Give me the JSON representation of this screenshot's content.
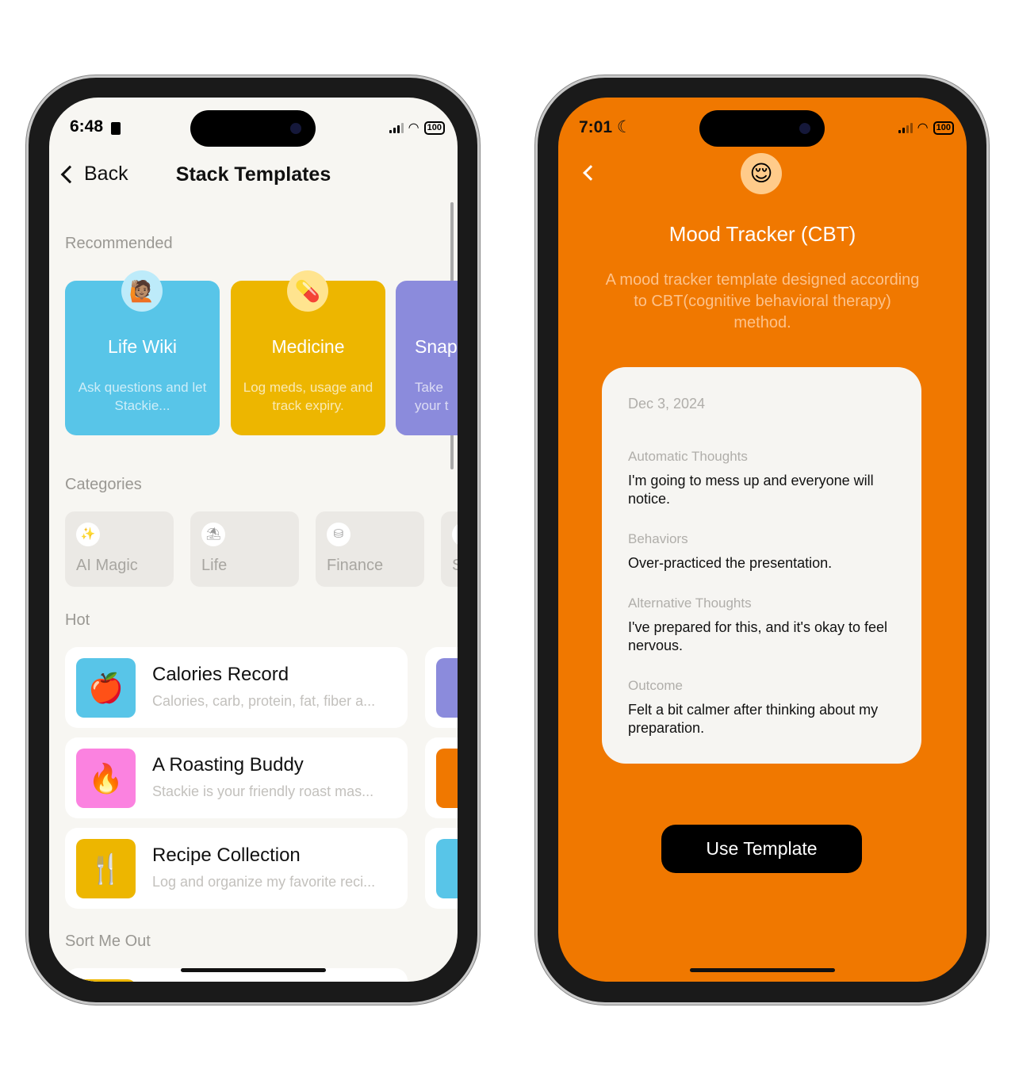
{
  "left_phone": {
    "status": {
      "time": "6:48",
      "battery": "100"
    },
    "nav": {
      "back_label": "Back",
      "title": "Stack Templates"
    },
    "sections": {
      "recommended": "Recommended",
      "categories": "Categories",
      "hot": "Hot",
      "sort_me_out": "Sort Me Out"
    },
    "recommended": [
      {
        "title": "Life Wiki",
        "description": "Ask questions and let Stackie...",
        "emoji": "🙋🏽",
        "color": "#58C5E8",
        "emoji_bg": "#BDEBFA"
      },
      {
        "title": "Medicine",
        "description": "Log meds, usage and track expiry.",
        "emoji": "💊",
        "color": "#EDB600",
        "emoji_bg": "#FFE48F"
      },
      {
        "title": "Snap",
        "description": "Take your t",
        "emoji": "",
        "color": "#8B8BDC",
        "emoji_bg": "#B9B9EE"
      }
    ],
    "categories": [
      {
        "label": "AI Magic",
        "icon": "magic-wand-icon"
      },
      {
        "label": "Life",
        "icon": "umbrella-icon"
      },
      {
        "label": "Finance",
        "icon": "coins-icon"
      },
      {
        "label": "S",
        "icon": "circle-icon"
      }
    ],
    "hot": [
      {
        "title": "Calories Record",
        "description": "Calories, carb, protein, fat, fiber a...",
        "emoji": "🍎",
        "color": "#58C5E8",
        "peek_color": "#8B8BDC"
      },
      {
        "title": "A Roasting Buddy",
        "description": "Stackie is your friendly roast mas...",
        "emoji": "🔥",
        "color": "#FB82E0",
        "peek_color": "#F07800"
      },
      {
        "title": "Recipe Collection",
        "description": "Log and organize my favorite reci...",
        "emoji": "🍴",
        "color": "#EDB600",
        "peek_color": "#58C5E8"
      }
    ]
  },
  "right_phone": {
    "status": {
      "time": "7:01",
      "battery": "100"
    },
    "emoji": "😌",
    "title": "Mood Tracker (CBT)",
    "description": "A mood tracker template designed according to CBT(cognitive behavioral therapy) method.",
    "accent": "#F07800",
    "card": {
      "date": "Dec 3, 2024",
      "fields": [
        {
          "label": "Automatic Thoughts",
          "value": "I'm going to mess up and everyone will notice."
        },
        {
          "label": "Behaviors",
          "value": "Over-practiced the presentation."
        },
        {
          "label": "Alternative Thoughts",
          "value": "I've prepared for this, and it's okay to feel nervous."
        },
        {
          "label": "Outcome",
          "value": "Felt a bit calmer after thinking about my preparation."
        }
      ]
    },
    "button": "Use Template"
  }
}
